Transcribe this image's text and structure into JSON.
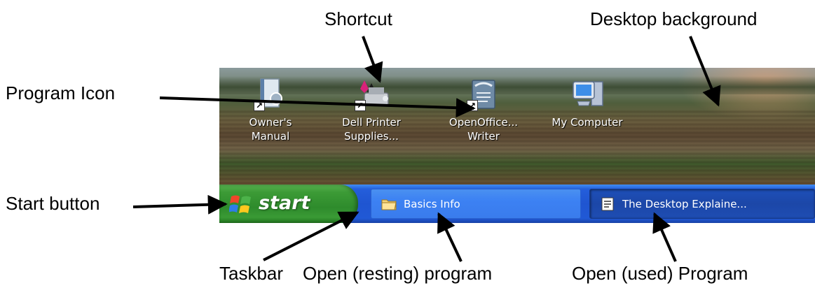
{
  "labels": {
    "shortcut": "Shortcut",
    "desktop_background": "Desktop background",
    "program_icon": "Program Icon",
    "start_button": "Start button",
    "taskbar": "Taskbar",
    "open_resting": "Open (resting) program",
    "open_used": "Open (used) Program"
  },
  "desktop_icons": [
    {
      "line1": "Owner's",
      "line2": "Manual",
      "icon": "manual-icon"
    },
    {
      "line1": "Dell Printer",
      "line2": "Supplies...",
      "icon": "printer-icon"
    },
    {
      "line1": "OpenOffice...",
      "line2": "Writer",
      "icon": "writer-icon"
    },
    {
      "line1": "My Computer",
      "line2": "",
      "icon": "my-computer-icon"
    }
  ],
  "taskbar": {
    "start_label": "start",
    "tasks": [
      {
        "label": "Basics Info",
        "icon": "folder-icon",
        "state": "resting"
      },
      {
        "label": "The Desktop Explaine...",
        "icon": "document-icon",
        "state": "active"
      }
    ]
  },
  "colors": {
    "taskbar_blue": "#245edb",
    "start_green": "#3c9b36",
    "arrow": "#000000",
    "label_text": "#000000"
  }
}
